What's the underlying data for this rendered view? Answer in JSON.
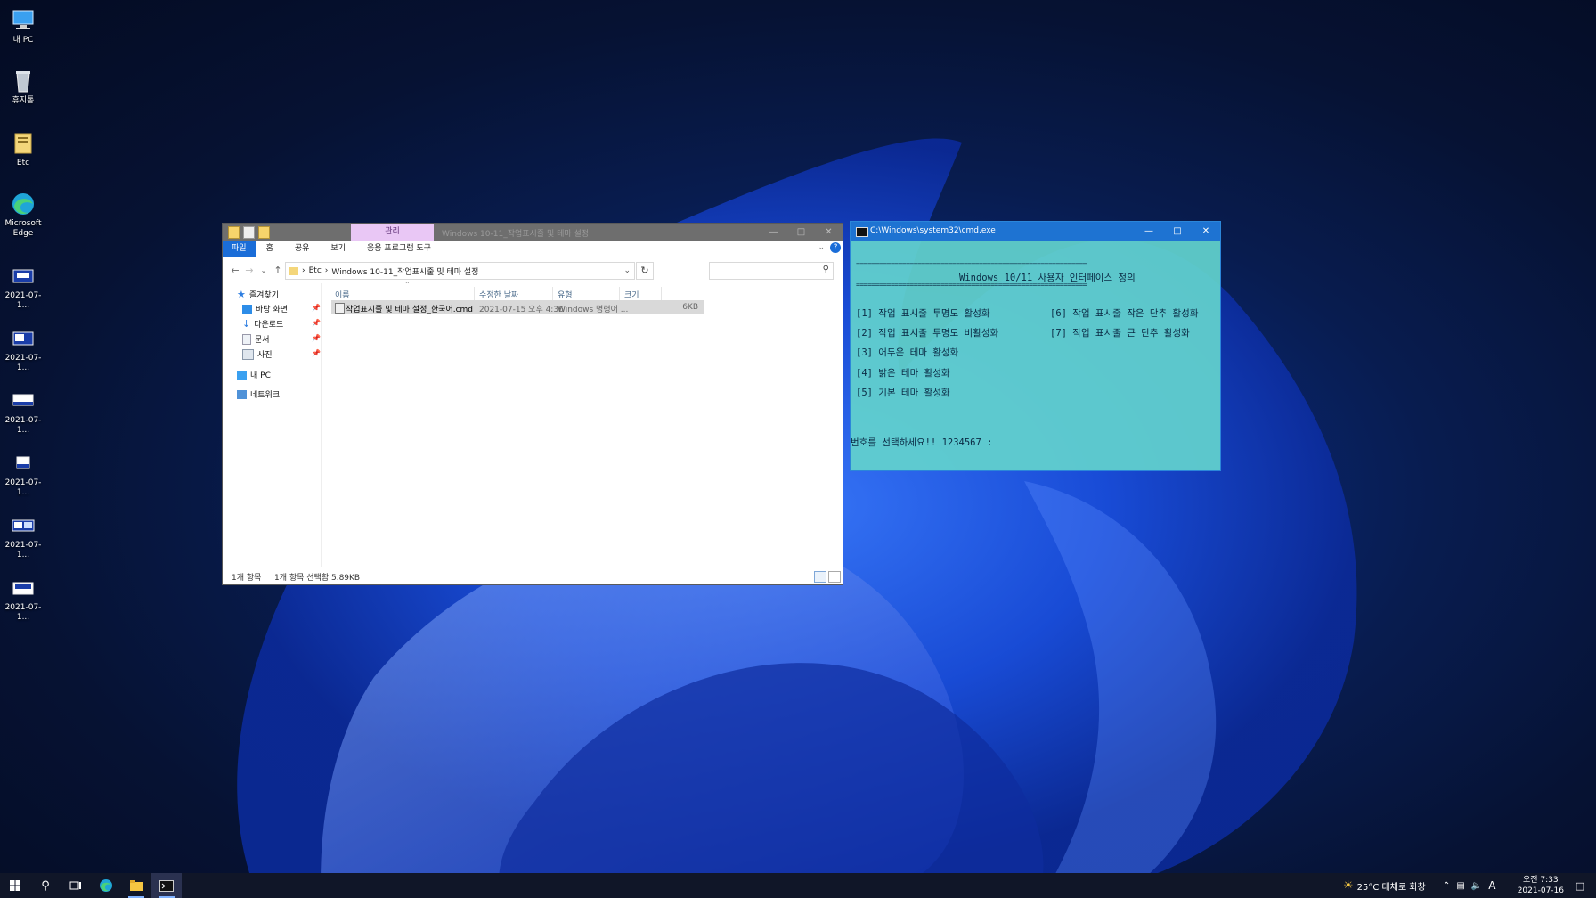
{
  "desktop": {
    "icons": [
      {
        "label": "내 PC",
        "icon": "this-pc-icon"
      },
      {
        "label": "휴지통",
        "icon": "recycle-bin-icon"
      },
      {
        "label": "Etc",
        "icon": "folder-icon"
      },
      {
        "label": "Microsoft Edge",
        "icon": "edge-icon"
      },
      {
        "label": "2021-07-1...",
        "icon": "screenshot-icon"
      },
      {
        "label": "2021-07-1...",
        "icon": "screenshot-icon"
      },
      {
        "label": "2021-07-1...",
        "icon": "screenshot-icon"
      },
      {
        "label": "2021-07-1...",
        "icon": "screenshot-icon"
      },
      {
        "label": "2021-07-1...",
        "icon": "screenshot-icon"
      },
      {
        "label": "2021-07-1...",
        "icon": "screenshot-icon"
      }
    ]
  },
  "explorer": {
    "title": "Windows 10-11_작업표시줄 및 테마 설정",
    "manage_tab": "관리",
    "ribbon_tabs": [
      "파일",
      "홈",
      "공유",
      "보기",
      "응용 프로그램 도구"
    ],
    "breadcrumb": [
      "Etc",
      "Windows 10-11_작업표시줄 및 테마 설정"
    ],
    "search_placeholder": "",
    "nav": {
      "quick_access": "즐겨찾기",
      "items": [
        "바탕 화면",
        "다운로드",
        "문서",
        "사진"
      ],
      "this_pc": "내 PC",
      "network": "네트워크"
    },
    "columns": [
      "이름",
      "수정한 날짜",
      "유형",
      "크기"
    ],
    "files": [
      {
        "name": "작업표시줄 및 테마 설정_한국어.cmd",
        "modified": "2021-07-15 오후 4:36",
        "type": "Windows 명령어 ...",
        "size": "6KB"
      }
    ],
    "status_count": "1개 항목",
    "status_selected": "1개 항목 선택함 5.89KB"
  },
  "cmd": {
    "title": "C:\\Windows\\system32\\cmd.exe",
    "separator": "============================================================",
    "heading": "Windows 10/11 사용자 인터페이스 정의",
    "options_left": [
      "[1] 작업 표시줄 투명도 활성화",
      "[2] 작업 표시줄 투명도 비활성화",
      "[3] 어두운 테마 활성화",
      "[4] 밝은 테마 활성화",
      "[5] 기본 테마 활성화"
    ],
    "options_right": [
      "[6] 작업 표시줄 작은 단추 활성화",
      "[7] 작업 표시줄 큰 단추 활성화"
    ],
    "prompt": "번호를 선택하세요!! 1234567 :"
  },
  "taskbar": {
    "weather": "25°C 대체로 화창",
    "ime": "A",
    "time": "오전 7:33",
    "date": "2021-07-16"
  }
}
